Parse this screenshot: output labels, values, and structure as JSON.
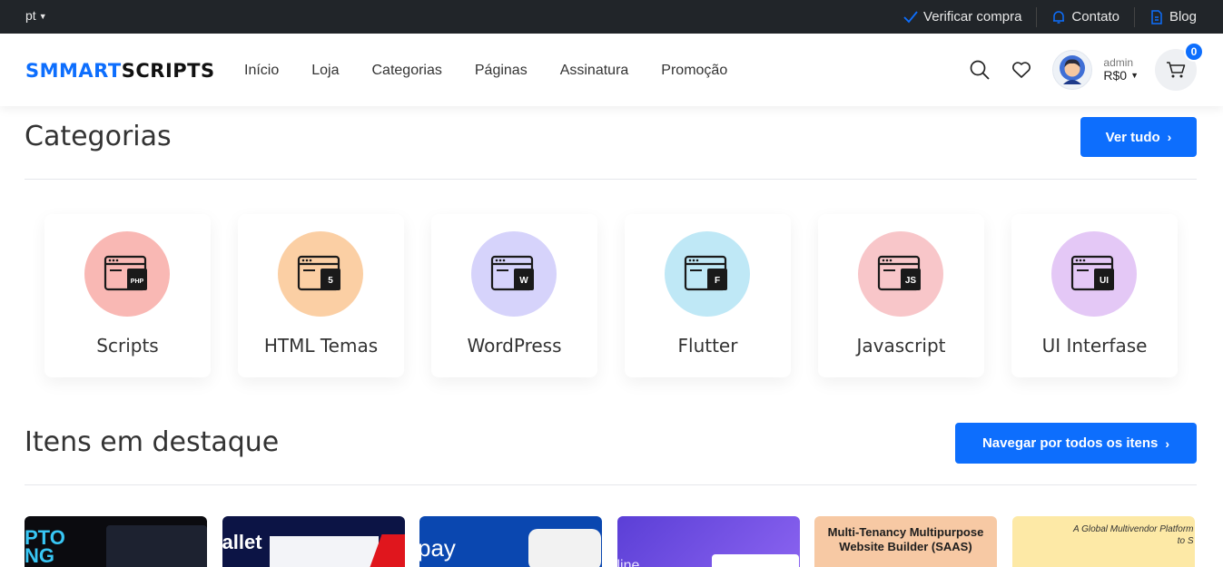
{
  "topbar": {
    "language": "pt",
    "links": [
      "Verificar compra",
      "Contato",
      "Blog"
    ]
  },
  "header": {
    "logo_part1": "SMMART",
    "logo_part2": "SCRIPTS",
    "nav": [
      "Início",
      "Loja",
      "Categorias",
      "Páginas",
      "Assinatura",
      "Promoção"
    ],
    "user": {
      "name": "admin",
      "balance": "R$0"
    },
    "cart_count": "0"
  },
  "categories_section": {
    "title": "Categorias",
    "button": "Ver tudo",
    "items": [
      {
        "label": "Scripts",
        "icon": "php-icon",
        "color": "#f9b8b4",
        "badge": "PHP"
      },
      {
        "label": "HTML Temas",
        "icon": "html5-icon",
        "color": "#fbcfa4",
        "badge": "5"
      },
      {
        "label": "WordPress",
        "icon": "wordpress-icon",
        "color": "#d6d3fb",
        "badge": "W"
      },
      {
        "label": "Flutter",
        "icon": "flutter-icon",
        "color": "#bfe8f6",
        "badge": "F"
      },
      {
        "label": "Javascript",
        "icon": "javascript-icon",
        "color": "#f8c6c9",
        "badge": "JS"
      },
      {
        "label": "UI Interfase",
        "icon": "ui-icon",
        "color": "#e4c8f6",
        "badge": "UI"
      }
    ]
  },
  "featured_section": {
    "title": "Itens em destaque",
    "button": "Navegar por todos os itens",
    "items": [
      {
        "text": "PTO\nNG"
      },
      {
        "text": "allet"
      },
      {
        "text": "pay"
      },
      {
        "text": "line"
      },
      {
        "text": "Multi-Tenancy Multipurpose Website Builder (SAAS)"
      },
      {
        "text": "A Global Multivendor Platform to S"
      }
    ]
  },
  "colors": {
    "accent": "#0d6efd",
    "topbar": "#212529"
  }
}
